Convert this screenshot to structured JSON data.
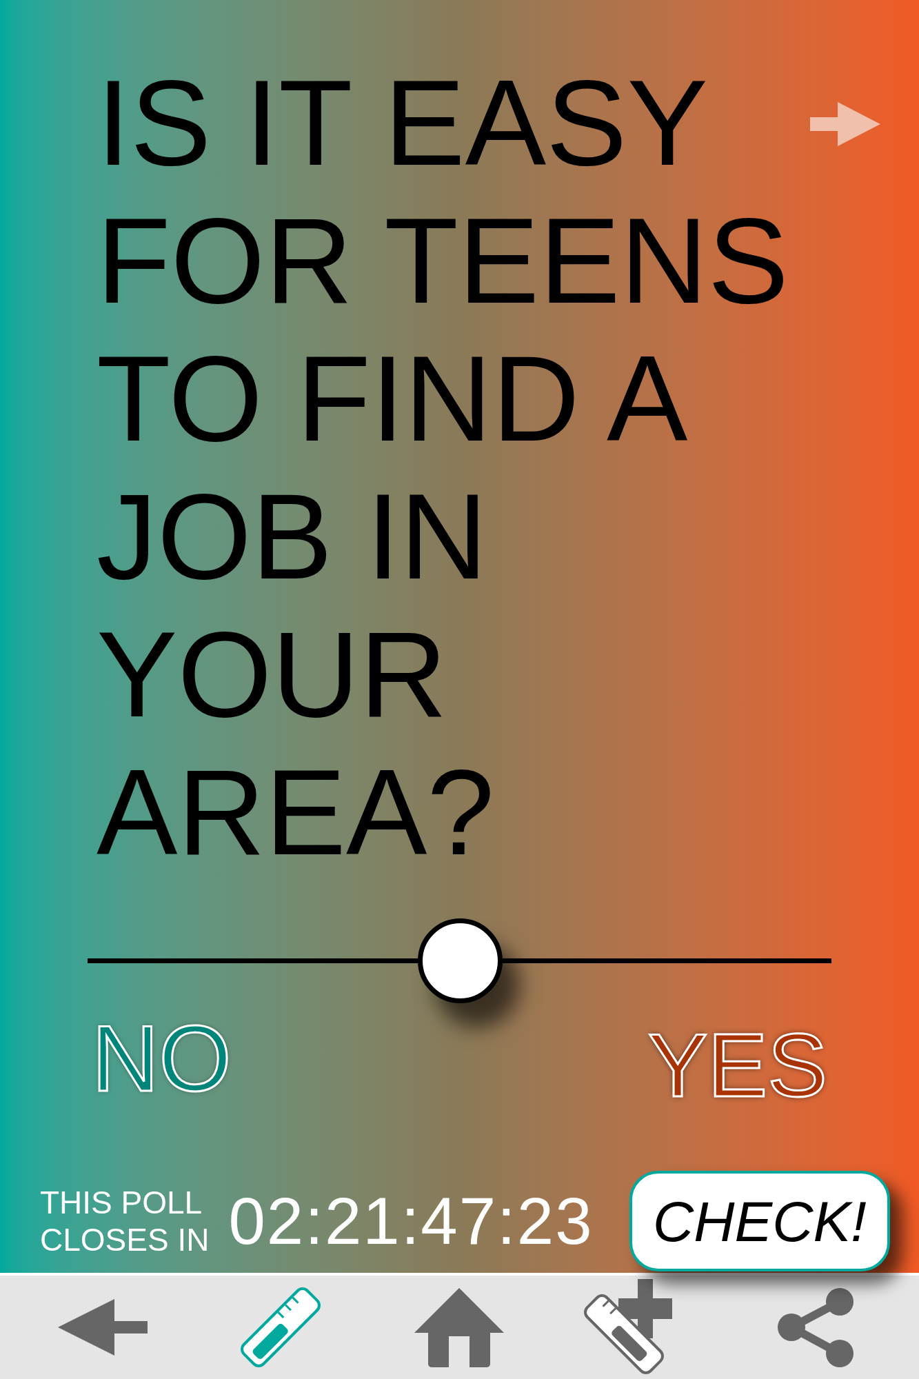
{
  "question_lines": [
    "IS IT EASY",
    "FOR TEENS",
    "TO FIND A",
    "JOB IN",
    "YOUR",
    "AREA?"
  ],
  "slider": {
    "level": 0.5,
    "min_label": "NO",
    "max_label": "YES"
  },
  "countdown": {
    "label_lines": [
      "THIS POLL",
      "CLOSES IN"
    ],
    "time": "02:21:47:23"
  },
  "check_button": "CHECK!",
  "nav": [
    {
      "kind": "back",
      "selected": false
    },
    {
      "kind": "ruler",
      "selected": true
    },
    {
      "kind": "home",
      "selected": false
    },
    {
      "kind": "ruler-add",
      "selected": false
    },
    {
      "kind": "share",
      "selected": false
    }
  ]
}
